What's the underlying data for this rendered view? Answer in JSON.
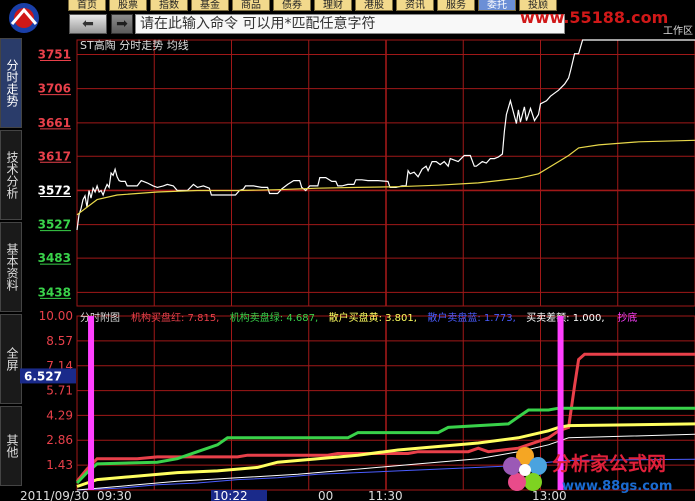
{
  "toolbar": {
    "items": [
      "首页",
      "股票",
      "指数",
      "基金",
      "商品",
      "债券",
      "理财",
      "港股",
      "资讯",
      "服务",
      "委托",
      "投顾"
    ],
    "active_index": 10
  },
  "nav": {
    "back_icon": "back-arrow-icon",
    "forward_icon": "forward-arrow-icon"
  },
  "command": {
    "placeholder": "请在此输入命令   可以用*匹配任意字符"
  },
  "watermark_url": "www.55188.com",
  "corner_label": "工作区",
  "side_tabs": [
    "分时走势",
    "技术分析",
    "基本资料",
    "全屏",
    "其他"
  ],
  "chart_data": [
    {
      "type": "line",
      "title": "ST高陶   分时走势  均线",
      "ylim": [
        3420,
        3770
      ],
      "y_ticks": [
        "3751",
        "3706",
        "3661",
        "3617",
        "3572",
        "3527",
        "3483",
        "3438"
      ],
      "y_tick_values": [
        3751,
        3706,
        3661,
        3617,
        3572,
        3527,
        3483,
        3438
      ],
      "y_tick_colors": [
        "#e8404a",
        "#e8404a",
        "#e8404a",
        "#e8404a",
        "#ffffff",
        "#39d24a",
        "#39d24a",
        "#39d24a"
      ],
      "series": [
        {
          "name": "price",
          "color": "#ffffff",
          "points": [
            [
              0,
              3520
            ],
            [
              2,
              3540
            ],
            [
              4,
              3548
            ],
            [
              6,
              3560
            ],
            [
              8,
              3565
            ],
            [
              10,
              3550
            ],
            [
              12,
              3572
            ],
            [
              14,
              3562
            ],
            [
              16,
              3575
            ],
            [
              18,
              3570
            ],
            [
              20,
              3578
            ],
            [
              22,
              3570
            ],
            [
              24,
              3572
            ],
            [
              26,
              3566
            ],
            [
              28,
              3574
            ],
            [
              30,
              3580
            ],
            [
              32,
              3576
            ],
            [
              34,
              3595
            ],
            [
              36,
              3592
            ],
            [
              38,
              3600
            ],
            [
              40,
              3590
            ],
            [
              42,
              3585
            ],
            [
              44,
              3584
            ],
            [
              46,
              3584
            ],
            [
              48,
              3584
            ],
            [
              50,
              3578
            ],
            [
              60,
              3578
            ],
            [
              64,
              3585
            ],
            [
              70,
              3582
            ],
            [
              76,
              3578
            ],
            [
              80,
              3576
            ],
            [
              86,
              3578
            ],
            [
              90,
              3580
            ],
            [
              96,
              3578
            ],
            [
              100,
              3572
            ],
            [
              110,
              3572
            ],
            [
              116,
              3580
            ],
            [
              120,
              3576
            ],
            [
              126,
              3578
            ],
            [
              132,
              3575
            ],
            [
              134,
              3566
            ],
            [
              138,
              3566
            ],
            [
              142,
              3566
            ],
            [
              150,
              3566
            ],
            [
              158,
              3566
            ],
            [
              162,
              3572
            ],
            [
              166,
              3574
            ],
            [
              168,
              3578
            ],
            [
              176,
              3578
            ],
            [
              184,
              3576
            ],
            [
              190,
              3576
            ],
            [
              192,
              3568
            ],
            [
              196,
              3568
            ],
            [
              200,
              3568
            ],
            [
              204,
              3574
            ],
            [
              210,
              3580
            ],
            [
              216,
              3585
            ],
            [
              222,
              3585
            ],
            [
              224,
              3576
            ],
            [
              228,
              3572
            ],
            [
              232,
              3578
            ],
            [
              240,
              3578
            ],
            [
              242,
              3589
            ],
            [
              248,
              3589
            ],
            [
              254,
              3584
            ],
            [
              258,
              3584
            ],
            [
              260,
              3578
            ],
            [
              264,
              3578
            ],
            [
              270,
              3580
            ],
            [
              276,
              3580
            ],
            [
              278,
              3586
            ],
            [
              284,
              3586
            ],
            [
              290,
              3585
            ],
            [
              296,
              3585
            ],
            [
              300,
              3585
            ],
            [
              310,
              3584
            ],
            [
              312,
              3576
            ],
            [
              318,
              3576
            ],
            [
              324,
              3578
            ],
            [
              328,
              3578
            ],
            [
              330,
              3598
            ],
            [
              332,
              3594
            ],
            [
              336,
              3596
            ],
            [
              340,
              3590
            ],
            [
              344,
              3600
            ],
            [
              348,
              3604
            ],
            [
              350,
              3598
            ],
            [
              354,
              3610
            ],
            [
              358,
              3610
            ],
            [
              362,
              3606
            ],
            [
              366,
              3610
            ],
            [
              370,
              3604
            ],
            [
              372,
              3614
            ],
            [
              376,
              3612
            ],
            [
              380,
              3610
            ],
            [
              386,
              3618
            ],
            [
              392,
              3618
            ],
            [
              396,
              3604
            ],
            [
              398,
              3604
            ],
            [
              404,
              3610
            ],
            [
              408,
              3608
            ],
            [
              412,
              3614
            ],
            [
              416,
              3614
            ],
            [
              420,
              3616
            ],
            [
              424,
              3620
            ],
            [
              426,
              3650
            ],
            [
              428,
              3672
            ],
            [
              432,
              3690
            ],
            [
              434,
              3680
            ],
            [
              438,
              3660
            ],
            [
              440,
              3678
            ],
            [
              442,
              3662
            ],
            [
              446,
              3682
            ],
            [
              448,
              3664
            ],
            [
              452,
              3680
            ],
            [
              456,
              3664
            ],
            [
              460,
              3672
            ],
            [
              462,
              3686
            ],
            [
              468,
              3690
            ],
            [
              472,
              3696
            ],
            [
              476,
              3700
            ],
            [
              480,
              3704
            ],
            [
              486,
              3712
            ],
            [
              490,
              3720
            ],
            [
              492,
              3730
            ],
            [
              496,
              3752
            ],
            [
              500,
              3752
            ],
            [
              504,
              3770
            ],
            [
              508,
              3770
            ],
            [
              616,
              3770
            ]
          ]
        },
        {
          "name": "avg",
          "color": "#e8d84a",
          "points": [
            [
              0,
              3540
            ],
            [
              20,
              3560
            ],
            [
              40,
              3566
            ],
            [
              80,
              3570
            ],
            [
              120,
              3572
            ],
            [
              160,
              3572
            ],
            [
              200,
              3573
            ],
            [
              240,
              3575
            ],
            [
              280,
              3576
            ],
            [
              320,
              3577
            ],
            [
              360,
              3579
            ],
            [
              400,
              3582
            ],
            [
              420,
              3585
            ],
            [
              440,
              3588
            ],
            [
              460,
              3594
            ],
            [
              480,
              3610
            ],
            [
              490,
              3618
            ],
            [
              500,
              3628
            ],
            [
              520,
              3632
            ],
            [
              560,
              3636
            ],
            [
              616,
              3638
            ]
          ]
        }
      ]
    },
    {
      "type": "line",
      "title": "分时附图",
      "legend": [
        {
          "label": "机构买盘红: 7.815,",
          "color": "#e8404a"
        },
        {
          "label": "机构卖盘绿: 4.687,",
          "color": "#39d24a"
        },
        {
          "label": "散户买盘黄: 3.801,",
          "color": "#ffff60"
        },
        {
          "label": "散户卖盘蓝: 1.773,",
          "color": "#4a5cff"
        },
        {
          "label": "买卖差额: 1.000,",
          "color": "#ffffff"
        },
        {
          "label": "抄底",
          "color": "#ff40ff"
        }
      ],
      "ylim": [
        0,
        10
      ],
      "y_ticks": [
        "10.00",
        "8.57",
        "7.14",
        "6.527",
        "5.71",
        "4.29",
        "2.86",
        "1.43"
      ],
      "y_tick_values": [
        10.0,
        8.57,
        7.14,
        6.527,
        5.71,
        4.29,
        2.86,
        1.43
      ],
      "highlight_value": "6.527",
      "series": [
        {
          "name": "机构买盘红",
          "color": "#e8404a",
          "points": [
            [
              0,
              0.5
            ],
            [
              10,
              1.2
            ],
            [
              20,
              1.8
            ],
            [
              60,
              1.8
            ],
            [
              80,
              1.9
            ],
            [
              160,
              1.9
            ],
            [
              170,
              2.0
            ],
            [
              250,
              2.0
            ],
            [
              260,
              2.1
            ],
            [
              330,
              2.1
            ],
            [
              340,
              2.2
            ],
            [
              390,
              2.2
            ],
            [
              400,
              2.4
            ],
            [
              410,
              2.2
            ],
            [
              440,
              2.4
            ],
            [
              460,
              2.8
            ],
            [
              470,
              3.0
            ],
            [
              480,
              3.4
            ],
            [
              490,
              3.6
            ],
            [
              496,
              6.0
            ],
            [
              500,
              7.5
            ],
            [
              506,
              7.8
            ],
            [
              616,
              7.8
            ]
          ]
        },
        {
          "name": "机构卖盘绿",
          "color": "#39d24a",
          "points": [
            [
              0,
              0.4
            ],
            [
              10,
              1.0
            ],
            [
              20,
              1.5
            ],
            [
              80,
              1.6
            ],
            [
              100,
              1.8
            ],
            [
              120,
              2.2
            ],
            [
              140,
              2.6
            ],
            [
              150,
              3.0
            ],
            [
              270,
              3.0
            ],
            [
              280,
              3.3
            ],
            [
              360,
              3.3
            ],
            [
              370,
              3.6
            ],
            [
              430,
              3.8
            ],
            [
              440,
              4.2
            ],
            [
              450,
              4.6
            ],
            [
              470,
              4.6
            ],
            [
              480,
              4.7
            ],
            [
              616,
              4.7
            ]
          ]
        },
        {
          "name": "散户买盘黄",
          "color": "#ffff60",
          "points": [
            [
              0,
              0.2
            ],
            [
              20,
              0.6
            ],
            [
              60,
              0.8
            ],
            [
              100,
              1.0
            ],
            [
              140,
              1.1
            ],
            [
              180,
              1.3
            ],
            [
              200,
              1.6
            ],
            [
              240,
              1.8
            ],
            [
              280,
              2.0
            ],
            [
              320,
              2.3
            ],
            [
              360,
              2.5
            ],
            [
              400,
              2.7
            ],
            [
              440,
              3.0
            ],
            [
              470,
              3.4
            ],
            [
              480,
              3.6
            ],
            [
              490,
              3.7
            ],
            [
              616,
              3.8
            ]
          ]
        },
        {
          "name": "散户卖盘蓝",
          "color": "#4a5cff",
          "points": [
            [
              0,
              0.0
            ],
            [
              40,
              0.1
            ],
            [
              80,
              0.3
            ],
            [
              120,
              0.4
            ],
            [
              160,
              0.6
            ],
            [
              200,
              0.7
            ],
            [
              240,
              0.9
            ],
            [
              280,
              1.0
            ],
            [
              320,
              1.1
            ],
            [
              360,
              1.2
            ],
            [
              400,
              1.3
            ],
            [
              440,
              1.4
            ],
            [
              470,
              1.6
            ],
            [
              490,
              1.7
            ],
            [
              616,
              1.77
            ]
          ]
        },
        {
          "name": "买卖差额",
          "color": "#ffffff",
          "points": [
            [
              0,
              0.0
            ],
            [
              60,
              0.3
            ],
            [
              100,
              0.5
            ],
            [
              160,
              0.7
            ],
            [
              220,
              0.9
            ],
            [
              280,
              1.2
            ],
            [
              340,
              1.5
            ],
            [
              400,
              1.8
            ],
            [
              440,
              2.2
            ],
            [
              470,
              2.6
            ],
            [
              490,
              3.0
            ],
            [
              616,
              3.2
            ]
          ]
        }
      ],
      "spikes": [
        {
          "x": 14,
          "value": 10.0,
          "color": "#ff40ff"
        },
        {
          "x": 482,
          "value": 10.0,
          "color": "#ff40ff"
        }
      ]
    }
  ],
  "time_axis": {
    "date": "2011/09/30",
    "labels": [
      "09:30",
      "10:22",
      "00",
      "11:30",
      "13:00"
    ],
    "highlight_index": 1
  },
  "watermark_brand": {
    "name": "分析家公式网",
    "url": "www.88gs.com"
  }
}
